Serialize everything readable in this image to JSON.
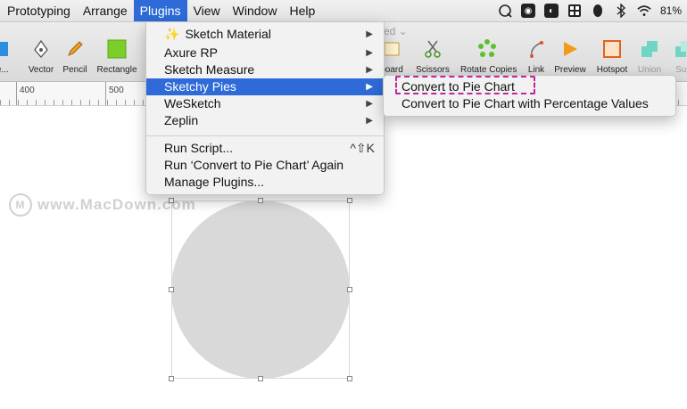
{
  "menubar": {
    "items": [
      "Prototyping",
      "Arrange",
      "Plugins",
      "View",
      "Window",
      "Help"
    ],
    "active_index": 2,
    "battery_label": "81%"
  },
  "toolbar": {
    "doc_title_fragment": "ited ⌄",
    "tools": [
      "ge...",
      "Vector",
      "Pencil",
      "Rectangle",
      "board",
      "Scissors",
      "Rotate Copies",
      "Link",
      "Preview",
      "Hotspot",
      "Union",
      "Sub"
    ]
  },
  "ruler": {
    "labels": [
      "400",
      "500"
    ]
  },
  "plugins_menu": {
    "items": [
      {
        "label": "Sketch Material",
        "has_submenu": true
      },
      {
        "label": "Axure RP",
        "has_submenu": true
      },
      {
        "label": "Sketch Measure",
        "has_submenu": true
      },
      {
        "label": "Sketchy Pies",
        "has_submenu": true
      },
      {
        "label": "WeSketch",
        "has_submenu": true
      },
      {
        "label": "Zeplin",
        "has_submenu": true
      }
    ],
    "actions": [
      {
        "label": "Run Script...",
        "shortcut": "^⇧K"
      },
      {
        "label": "Run ‘Convert to Pie Chart’ Again"
      },
      {
        "label": "Manage Plugins..."
      }
    ],
    "highlighted_index": 3
  },
  "sketchy_pies_submenu": {
    "items": [
      "Convert to Pie Chart",
      "Convert to Pie Chart with Percentage Values"
    ]
  },
  "watermark": {
    "text": "www.MacDown.com"
  },
  "colors": {
    "menu_highlight": "#2e6bd8",
    "annotation_dash": "#c4259c",
    "oval_fill": "#d9d9d9"
  }
}
